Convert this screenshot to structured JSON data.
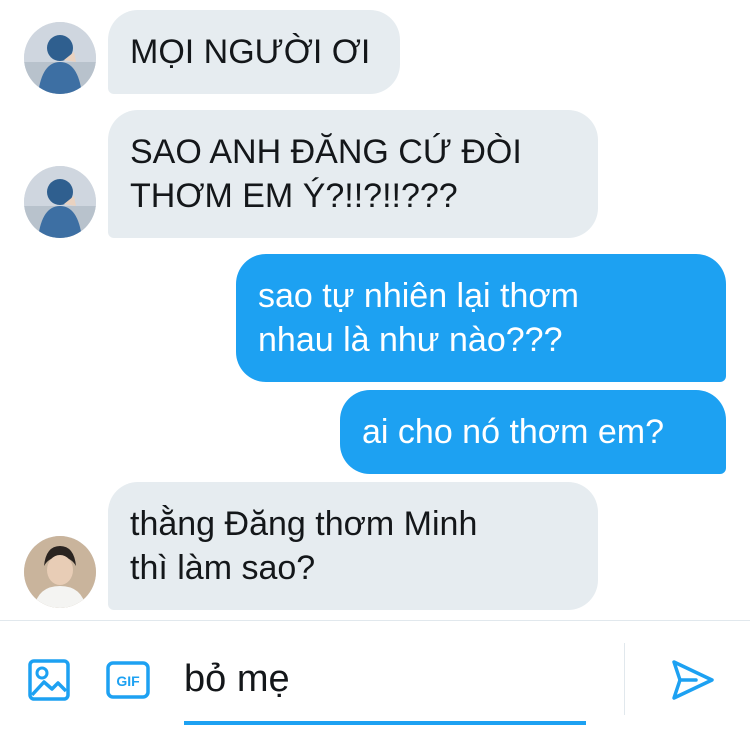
{
  "messages": [
    {
      "side": "incoming",
      "text": "MỌI NGƯỜI ƠI"
    },
    {
      "side": "incoming",
      "text": "SAO ANH ĐĂNG CỨ ĐÒI\nTHƠM EM Ý?!!?!!???"
    },
    {
      "side": "outgoing",
      "text": "sao tự nhiên lại thơm\nnhau là như nào???"
    },
    {
      "side": "outgoing",
      "text": "ai cho nó thơm em?"
    },
    {
      "side": "incoming",
      "text": "thằng Đăng thơm Minh\nthì làm sao?"
    }
  ],
  "composer": {
    "input_value": "bỏ mẹ",
    "gif_label": "GIF"
  },
  "colors": {
    "accent": "#1da1f2",
    "incoming_bubble": "#e6ecf0"
  }
}
